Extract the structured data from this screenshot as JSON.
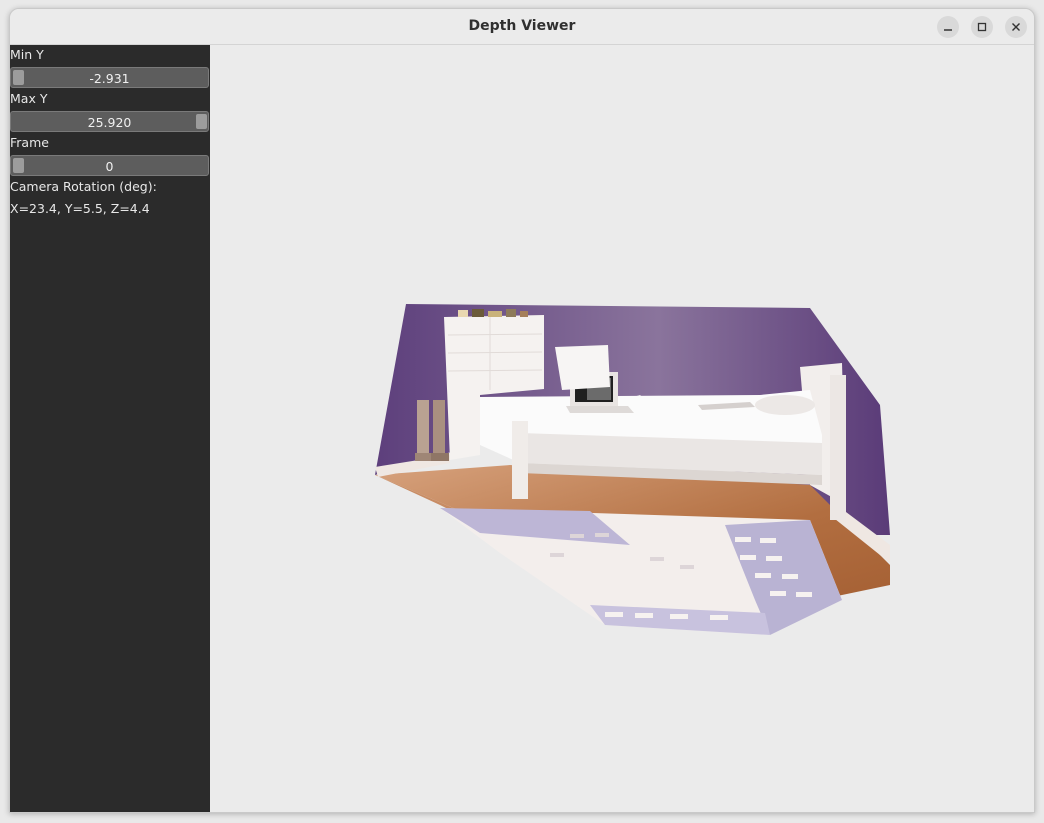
{
  "window": {
    "title": "Depth Viewer"
  },
  "controls": {
    "min_y": {
      "label": "Min Y",
      "value": "-2.931",
      "level": 0.0
    },
    "max_y": {
      "label": "Max Y",
      "value": "25.920",
      "level": 1.0
    },
    "frame": {
      "label": "Frame",
      "value": "0",
      "level": 0.0
    },
    "camera_rotation": {
      "label": "Camera Rotation (deg):",
      "value": "X=23.4, Y=5.5, Z=4.4"
    }
  },
  "viewport": {
    "content": "point-cloud-render"
  },
  "colors": {
    "sidebar_bg": "#2b2b2b",
    "slider_bg": "#5d5d5d",
    "viewport_bg": "#ebebeb",
    "wall": "#6a4a86",
    "floor": "#b8754a"
  }
}
